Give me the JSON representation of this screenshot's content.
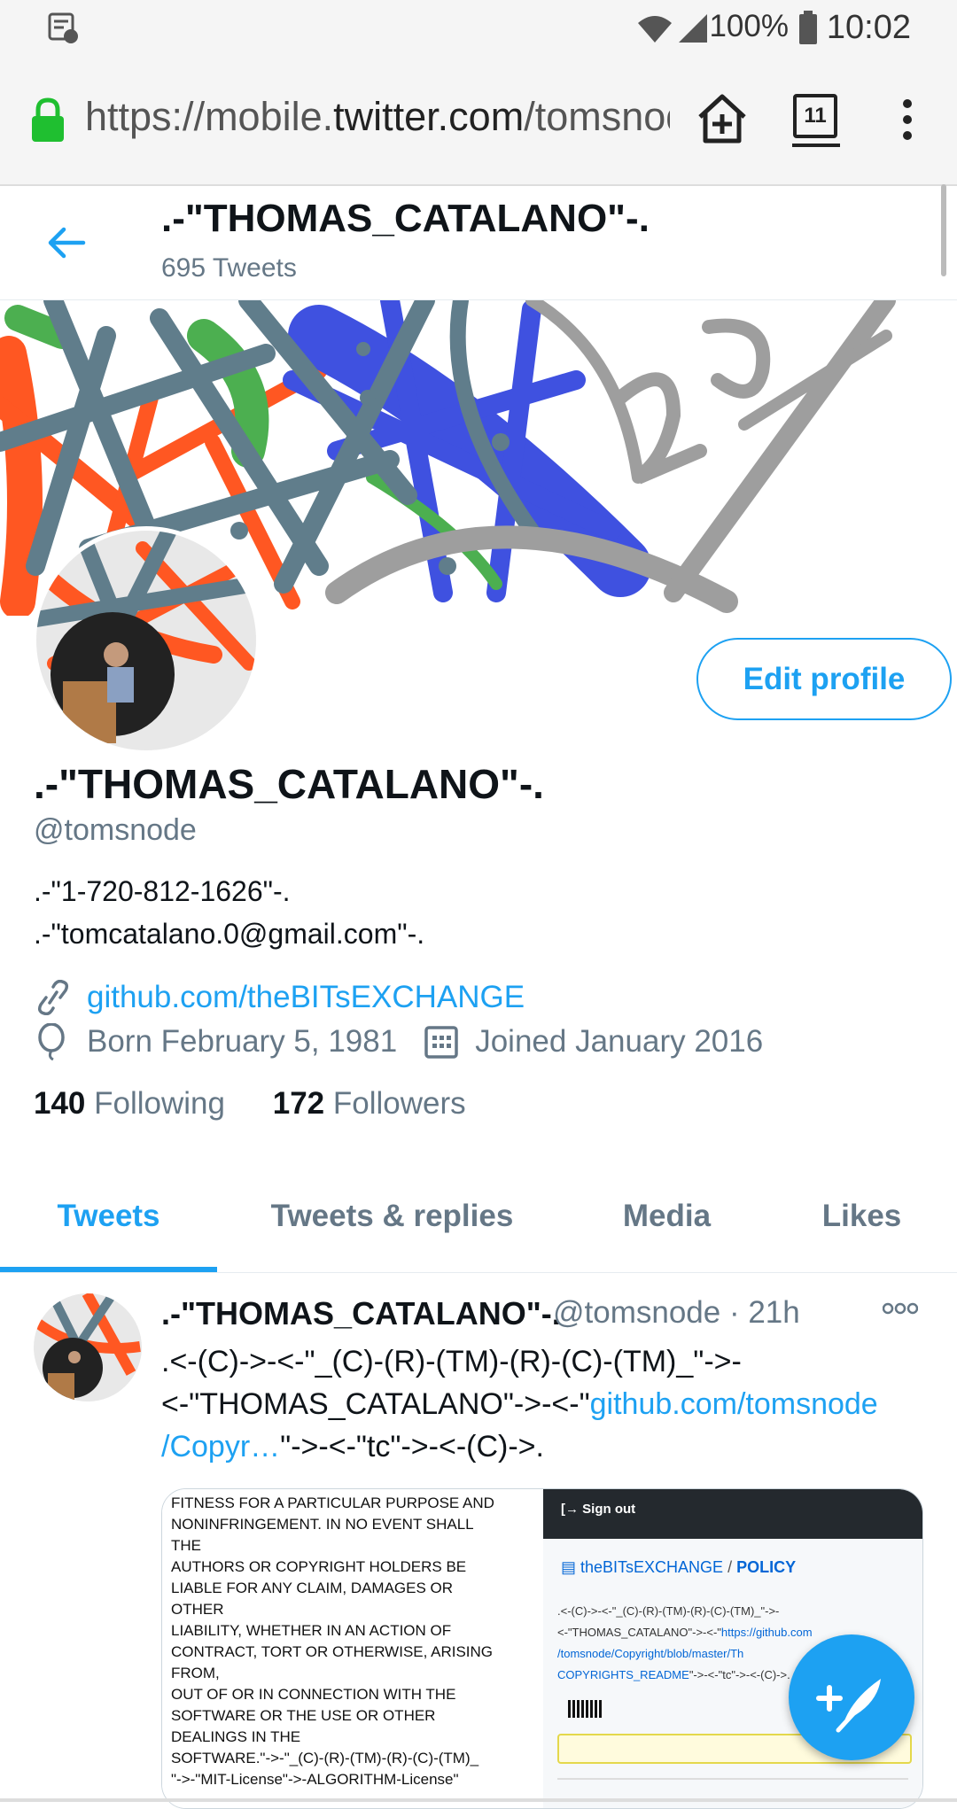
{
  "status_bar": {
    "battery": "100%",
    "time": "10:02"
  },
  "browser": {
    "url_scheme": "https://mobile.",
    "url_host": "twitter.com",
    "url_path": "/tomsnode",
    "tab_count": "11"
  },
  "header": {
    "title": ".-\"THOMAS_CATALANO\"-.",
    "tweet_count": "695 Tweets"
  },
  "profile": {
    "edit_label": "Edit profile",
    "name": ".-\"THOMAS_CATALANO\"-.",
    "handle": "@tomsnode",
    "bio_line1": ".-\"1-720-812-1626\"-.",
    "bio_line2": ".-\"tomcatalano.0@gmail.com\"-.",
    "website": "github.com/theBITsEXCHANGE",
    "born": "Born February 5, 1981",
    "joined": "Joined January 2016",
    "following_count": "140",
    "following_label": "Following",
    "followers_count": "172",
    "followers_label": "Followers"
  },
  "tabs": [
    "Tweets",
    "Tweets & replies",
    "Media",
    "Likes"
  ],
  "tweet": {
    "name": ".-\"THOMAS_CATALANO\"-.",
    "handle_time": "@tomsnode · 21h",
    "line1": ".<-(C)->-<-\"_(C)-(R)-(TM)-(R)-(C)-(TM)_\"->-",
    "line2_text": "<-\"THOMAS_CATALANO\"->-<-\"",
    "line2_link": "github.com/tomsnode",
    "line3_link": "/Copyr…",
    "line3_text": "\"->-<-\"tc\"->-<-(C)->.",
    "media": {
      "left_lines": [
        "FITNESS FOR A PARTICULAR PURPOSE AND",
        "NONINFRINGEMENT. IN NO EVENT SHALL",
        "THE",
        "AUTHORS OR COPYRIGHT HOLDERS BE",
        "LIABLE FOR ANY CLAIM, DAMAGES OR",
        "OTHER",
        "LIABILITY, WHETHER IN AN ACTION OF",
        "CONTRACT, TORT OR OTHERWISE, ARISING",
        "FROM,",
        "OUT OF OR IN CONNECTION WITH THE",
        "SOFTWARE OR THE USE OR OTHER",
        "DEALINGS IN THE",
        "SOFTWARE.\"->-\"_(C)-(R)-(TM)-(R)-(C)-(TM)_",
        "\"->-\"MIT-License\"->-ALGORITHM-License\""
      ],
      "sign_out": "Sign out",
      "repo_owner": "theBITsEXCHANGE",
      "repo_sep": " / ",
      "repo_name": "POLICY",
      "right_line1": ".<-(C)->-<-\"_(C)-(R)-(TM)-(R)-(C)-(TM)_\"->-",
      "right_line2": "<-\"THOMAS_CATALANO\"->-<-\"",
      "right_link1": "https://github.com",
      "right_link2": "/tomsnode/Copyright/blob/master/Th",
      "right_link3": "COPYRIGHTS_README",
      "right_tail": "\"->-<-\"tc\"->-<-(C)->."
    }
  },
  "colors": {
    "accent": "#1da1f2",
    "text": "#0f1419",
    "muted": "#657786"
  }
}
